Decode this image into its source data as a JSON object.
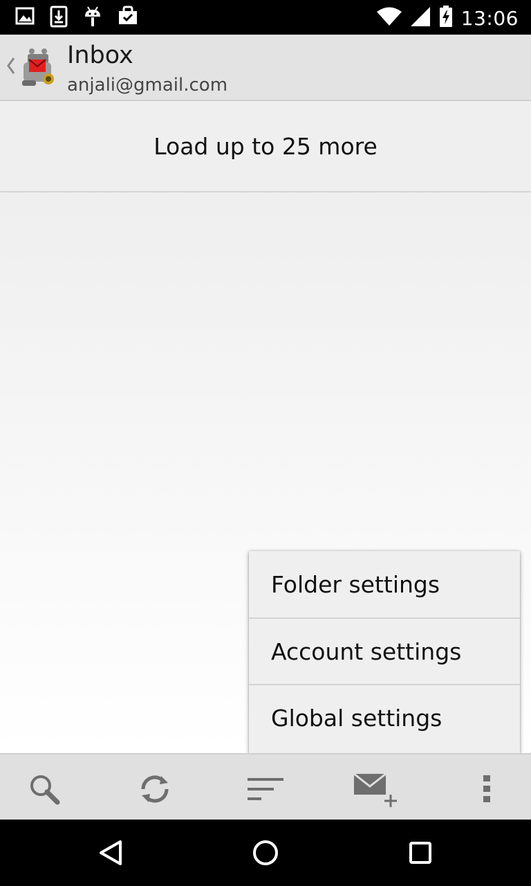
{
  "status_bar": {
    "time": "13:06",
    "icons": [
      "gallery-icon",
      "download-icon",
      "android-icon",
      "shopping-bag-icon",
      "wifi-icon",
      "signal-icon",
      "battery-charging-icon"
    ]
  },
  "header": {
    "title": "Inbox",
    "account": "anjali@gmail.com",
    "back_icon": "chevron-left-icon",
    "logo_icon": "mail-app-logo-icon"
  },
  "content": {
    "load_more_label": "Load up to 25 more"
  },
  "overflow_menu": {
    "items": [
      {
        "label": "Folder settings"
      },
      {
        "label": "Account settings"
      },
      {
        "label": "Global settings"
      }
    ]
  },
  "toolbar": {
    "icons": [
      "search-icon",
      "refresh-icon",
      "sort-icon",
      "compose-icon",
      "overflow-icon"
    ]
  },
  "nav": {
    "icons": [
      "back-icon",
      "home-icon",
      "recents-icon"
    ]
  }
}
